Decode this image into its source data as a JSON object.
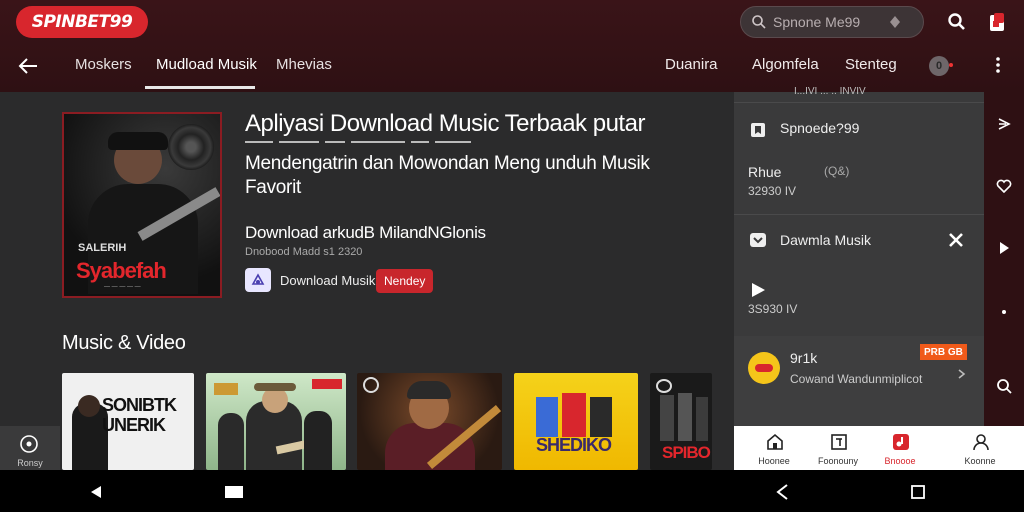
{
  "header": {
    "logo_text": "SPINBET99",
    "search_placeholder": "Spnone Me99",
    "tabs": [
      {
        "label": "Moskers"
      },
      {
        "label": "Mudload Musik",
        "active": true
      },
      {
        "label": "Mhevias"
      }
    ],
    "right_tabs": [
      {
        "label": "Duanira"
      },
      {
        "label": "Algomfela"
      },
      {
        "label": "Stenteg"
      }
    ],
    "badge_text": "0"
  },
  "hero": {
    "cover_title": "SALERIH",
    "cover_subtitle": "Syabefah",
    "headline": "Apliyasi Download Music Terbaak putar",
    "subheadline": "Mendengatrin dan Mowondan Meng unduh Musik Favorit",
    "download_title": "Download arkudB MilandNGlonis",
    "download_meta": "Dnobood Madd s1 2320",
    "chip_label": "Download Musik",
    "chip_badge": "Nendey"
  },
  "section": {
    "title": "Music & Video",
    "cards": [
      {
        "label": "SONIBTK UNERIK"
      },
      {
        "label": ""
      },
      {
        "label": ""
      },
      {
        "label": "SHEDIKO"
      },
      {
        "label": "SPIBO"
      }
    ]
  },
  "side_panel": {
    "top_faint": "I...IVI ... .. INVIV",
    "item1_label": "Spnoede?99",
    "item2_title": "Rhue",
    "item2_meta": "32930 IV",
    "item2_code": "(Q&)",
    "item3_label": "Dawmla Musik",
    "item4_meta": "3S930 IV",
    "promo_title": "9r1k",
    "promo_sub": "Cowand Wandunmiplicot",
    "promo_badge": "PRB GB"
  },
  "bottom_nav": [
    {
      "label": "Hoonee",
      "icon": "home-icon"
    },
    {
      "label": "Foonouny",
      "icon": "library-icon"
    },
    {
      "label": "Bnoooe",
      "icon": "music-app-icon",
      "active": true
    },
    {
      "label": "Koonne",
      "icon": "profile-icon"
    }
  ],
  "left_float": {
    "label": "Ronsy"
  },
  "colors": {
    "accent": "#d8262d",
    "header_bg": "#2e1013",
    "main_bg": "#2b2b2c",
    "panel_bg": "#3a3a3b"
  }
}
